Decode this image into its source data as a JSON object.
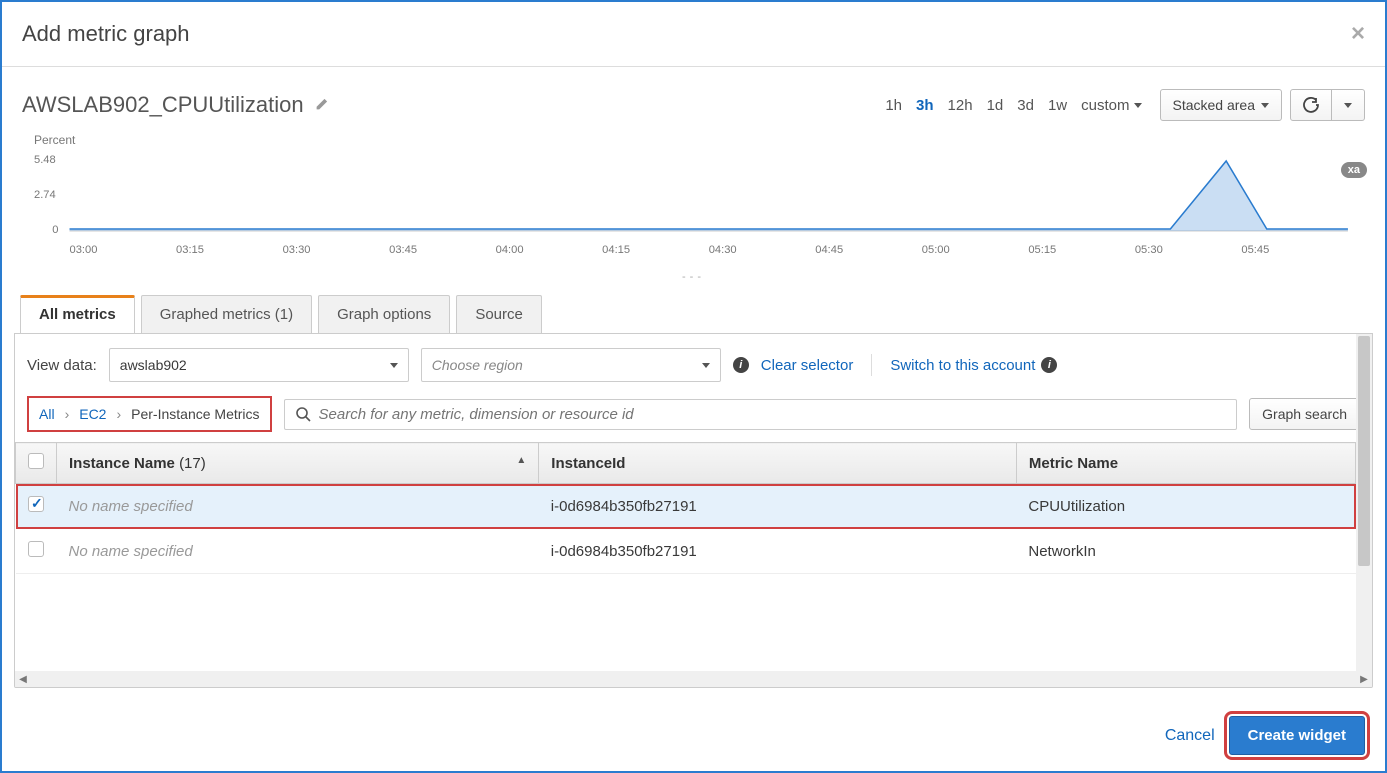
{
  "modal": {
    "title": "Add metric graph"
  },
  "graph": {
    "title": "AWSLAB902_CPUUtilization"
  },
  "timeRange": {
    "h1": "1h",
    "h3": "3h",
    "h12": "12h",
    "d1": "1d",
    "d3": "3d",
    "w1": "1w",
    "custom": "custom"
  },
  "chartTypeBtn": "Stacked area",
  "badge": "xa",
  "chart_data": {
    "type": "area",
    "title": "",
    "xlabel": "",
    "ylabel": "Percent",
    "ylim": [
      0,
      5.48
    ],
    "yticks": [
      0,
      2.74,
      5.48
    ],
    "categories": [
      "03:00",
      "03:15",
      "03:30",
      "03:45",
      "04:00",
      "04:15",
      "04:30",
      "04:45",
      "05:00",
      "05:15",
      "05:30",
      "05:45"
    ],
    "series": [
      {
        "name": "CPUUtilization",
        "values": [
          0.1,
          0.1,
          0.1,
          0.1,
          0.1,
          0.1,
          0.1,
          0.1,
          0.1,
          0.1,
          0.1,
          5.48,
          0.1
        ]
      }
    ]
  },
  "tabs": {
    "all": "All metrics",
    "graphed": "Graphed metrics (1)",
    "options": "Graph options",
    "source": "Source"
  },
  "viewData": {
    "label": "View data:",
    "account": "awslab902",
    "regionPlaceholder": "Choose region",
    "clear": "Clear selector",
    "switch": "Switch to this account"
  },
  "breadcrumbs": {
    "all": "All",
    "ec2": "EC2",
    "current": "Per-Instance Metrics"
  },
  "search": {
    "placeholder": "Search for any metric, dimension or resource id"
  },
  "graphSearchBtn": "Graph search",
  "table": {
    "cols": {
      "instanceName": "Instance Name",
      "count": "(17)",
      "instanceId": "InstanceId",
      "metricName": "Metric Name"
    },
    "rows": [
      {
        "selected": true,
        "name": "No name specified",
        "id": "i-0d6984b350fb27191",
        "metric": "CPUUtilization",
        "highlight": true
      },
      {
        "selected": false,
        "name": "No name specified",
        "id": "i-0d6984b350fb27191",
        "metric": "NetworkIn",
        "highlight": false
      }
    ]
  },
  "footer": {
    "cancel": "Cancel",
    "create": "Create widget"
  }
}
